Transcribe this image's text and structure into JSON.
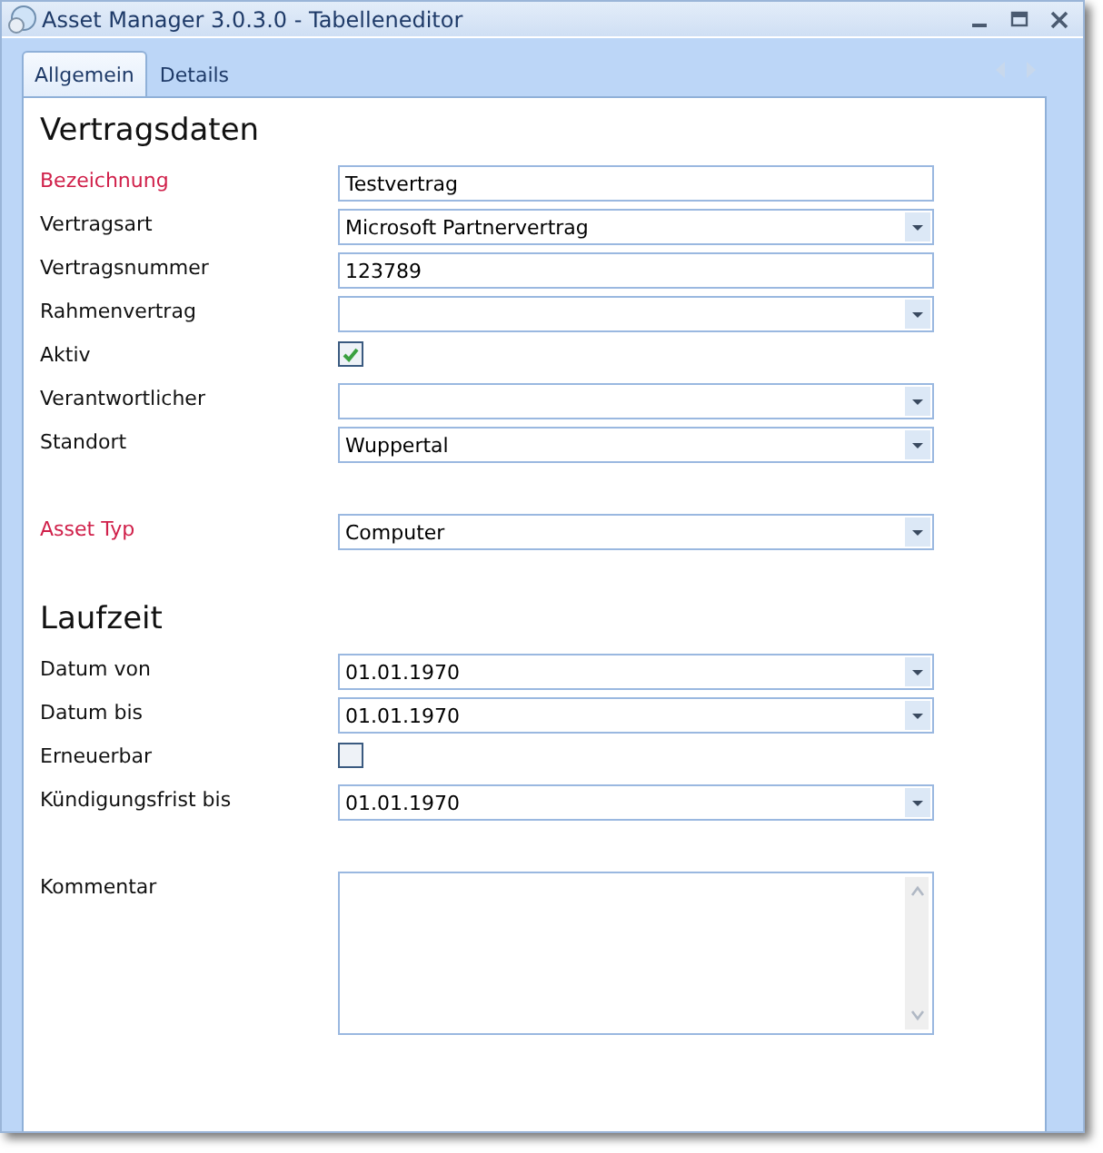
{
  "window": {
    "title": "Asset Manager 3.0.3.0 - Tabelleneditor"
  },
  "tabs": [
    {
      "label": "Allgemein",
      "selected": true
    },
    {
      "label": "Details",
      "selected": false
    }
  ],
  "sections": [
    {
      "title": "Vertragsdaten",
      "groups": [
        [
          {
            "kind": "text",
            "label": "Bezeichnung",
            "required": true,
            "value": "Testvertrag"
          },
          {
            "kind": "combo",
            "label": "Vertragsart",
            "required": false,
            "value": "Microsoft Partnervertrag"
          },
          {
            "kind": "text",
            "label": "Vertragsnummer",
            "required": false,
            "value": "123789"
          },
          {
            "kind": "combo",
            "label": "Rahmenvertrag",
            "required": false
          },
          {
            "kind": "checkbox",
            "label": "Aktiv",
            "required": false,
            "checked": true
          },
          {
            "kind": "combo",
            "label": "Verantwortlicher",
            "required": false
          },
          {
            "kind": "combo",
            "label": "Standort",
            "required": false,
            "value": "Wuppertal"
          }
        ],
        [
          {
            "kind": "combo",
            "label": "Asset Typ",
            "required": true,
            "value": "Computer"
          }
        ]
      ]
    },
    {
      "title": "Laufzeit",
      "groups": [
        [
          {
            "kind": "combo",
            "label": "Datum von",
            "required": false,
            "value": "01.01.1970"
          },
          {
            "kind": "combo",
            "label": "Datum bis",
            "required": false,
            "value": "01.01.1970"
          },
          {
            "kind": "checkbox",
            "label": "Erneuerbar",
            "required": false,
            "checked": false
          },
          {
            "kind": "combo",
            "label": "Kündigungsfrist bis",
            "required": false,
            "value": "01.01.1970"
          }
        ],
        [
          {
            "kind": "textarea",
            "label": "Kommentar",
            "required": false
          }
        ]
      ]
    }
  ]
}
